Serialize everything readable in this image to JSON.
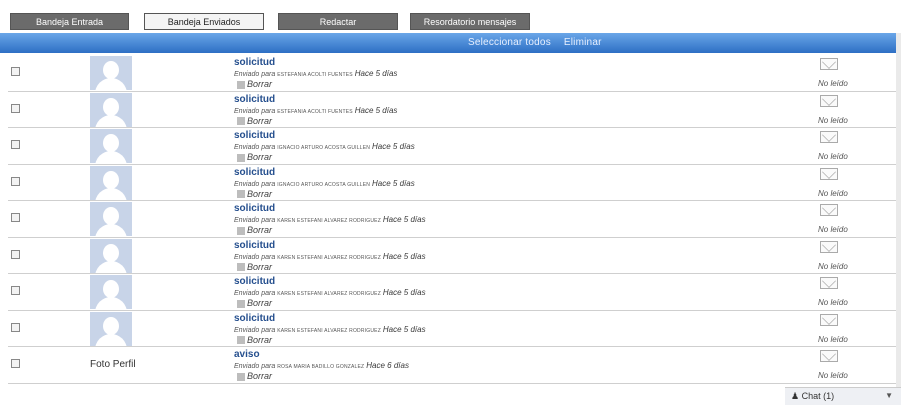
{
  "tabs": [
    {
      "label": "Bandeja Entrada",
      "style": "dark"
    },
    {
      "label": "Bandeja Enviados",
      "style": "light"
    },
    {
      "label": "Redactar",
      "style": "dark"
    },
    {
      "label": "Resordatorio mensajes",
      "style": "dark"
    }
  ],
  "actions": {
    "select_all": "Seleccionar todos",
    "delete": "Eliminar"
  },
  "messages": [
    {
      "subject": "solicitud",
      "sent_label": "Enviado para",
      "recipient": "ESTEFANIA ACOLTI FUENTES",
      "time": "Hace 5 días",
      "delete": "Borrar",
      "status": "No leído"
    },
    {
      "subject": "solicitud",
      "sent_label": "Enviado para",
      "recipient": "ESTEFANIA ACOLTI FUENTES",
      "time": "Hace 5 días",
      "delete": "Borrar",
      "status": "No leído"
    },
    {
      "subject": "solicitud",
      "sent_label": "Enviado para",
      "recipient": "IGNACIO ARTURO ACOSTA GUILLEN",
      "time": "Hace 5 días",
      "delete": "Borrar",
      "status": "No leído"
    },
    {
      "subject": "solicitud",
      "sent_label": "Enviado para",
      "recipient": "IGNACIO ARTURO ACOSTA GUILLEN",
      "time": "Hace 5 días",
      "delete": "Borrar",
      "status": "No leído"
    },
    {
      "subject": "solicitud",
      "sent_label": "Enviado para",
      "recipient": "KAREN ESTEFANI ALVAREZ RODRIGUEZ",
      "time": "Hace 5 días",
      "delete": "Borrar",
      "status": "No leído"
    },
    {
      "subject": "solicitud",
      "sent_label": "Enviado para",
      "recipient": "KAREN ESTEFANI ALVAREZ RODRIGUEZ",
      "time": "Hace 5 días",
      "delete": "Borrar",
      "status": "No leído"
    },
    {
      "subject": "solicitud",
      "sent_label": "Enviado para",
      "recipient": "KAREN ESTEFANI ALVAREZ RODRIGUEZ",
      "time": "Hace 5 días",
      "delete": "Borrar",
      "status": "No leído"
    },
    {
      "subject": "solicitud",
      "sent_label": "Enviado para",
      "recipient": "KAREN ESTEFANI ALVAREZ RODRIGUEZ",
      "time": "Hace 5 días",
      "delete": "Borrar",
      "status": "No leído"
    },
    {
      "subject": "aviso",
      "sent_label": "Enviado para",
      "recipient": "ROSA MARIA BADILLO GONZALEZ",
      "time": "Hace 6 días",
      "delete": "Borrar",
      "status": "No leído",
      "photo_label": "Foto Perfil"
    }
  ],
  "chat": {
    "label": "Chat (1)"
  }
}
